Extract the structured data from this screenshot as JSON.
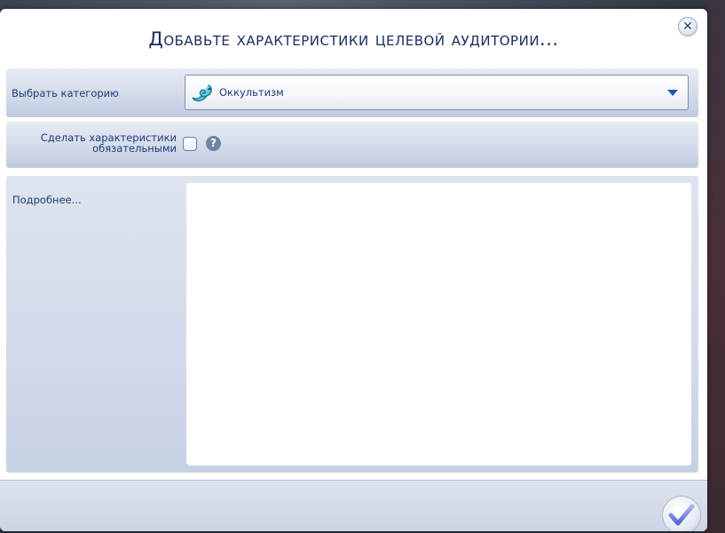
{
  "dialog": {
    "title": "Добавьте характеристики целевой аудитории...",
    "close_icon": "close-icon",
    "confirm_icon": "checkmark-icon"
  },
  "category": {
    "label": "Выбрать категорию",
    "selected_value": "Оккультизм",
    "selected_icon": "occult-wisp-icon",
    "dropdown_icon": "chevron-down-icon"
  },
  "required": {
    "label": "Сделать характеристики обязательными",
    "checked": false,
    "help_icon": "question-mark-icon"
  },
  "details": {
    "label": "Подробнее...",
    "value": ""
  },
  "colors": {
    "title_text": "#1a2b5e",
    "label_text": "#1e3a78",
    "accent": "#1f56b8",
    "panel": "#d3dbea"
  }
}
